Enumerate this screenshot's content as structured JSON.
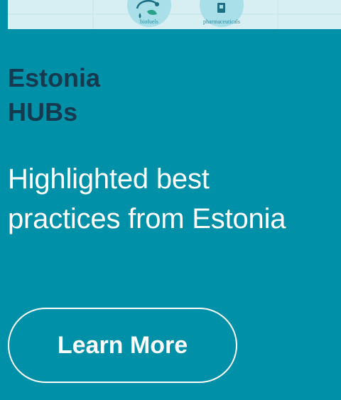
{
  "banner": {
    "items": [
      {
        "caption": "biofuels",
        "icon": "biofuel-pump-icon"
      },
      {
        "caption": "pharmaceuticals",
        "icon": "pharmaceuticals-icon"
      }
    ]
  },
  "hub": {
    "eyebrow_line1": "Estonia",
    "eyebrow_line2": "HUBs",
    "headline_line1": "Highlighted best",
    "headline_line2": "practices from Estonia",
    "cta_label": "Learn More"
  },
  "colors": {
    "background": "#0090a8",
    "eyebrow": "#153a4f",
    "text": "#ffffff",
    "banner": "#d7eff3"
  }
}
